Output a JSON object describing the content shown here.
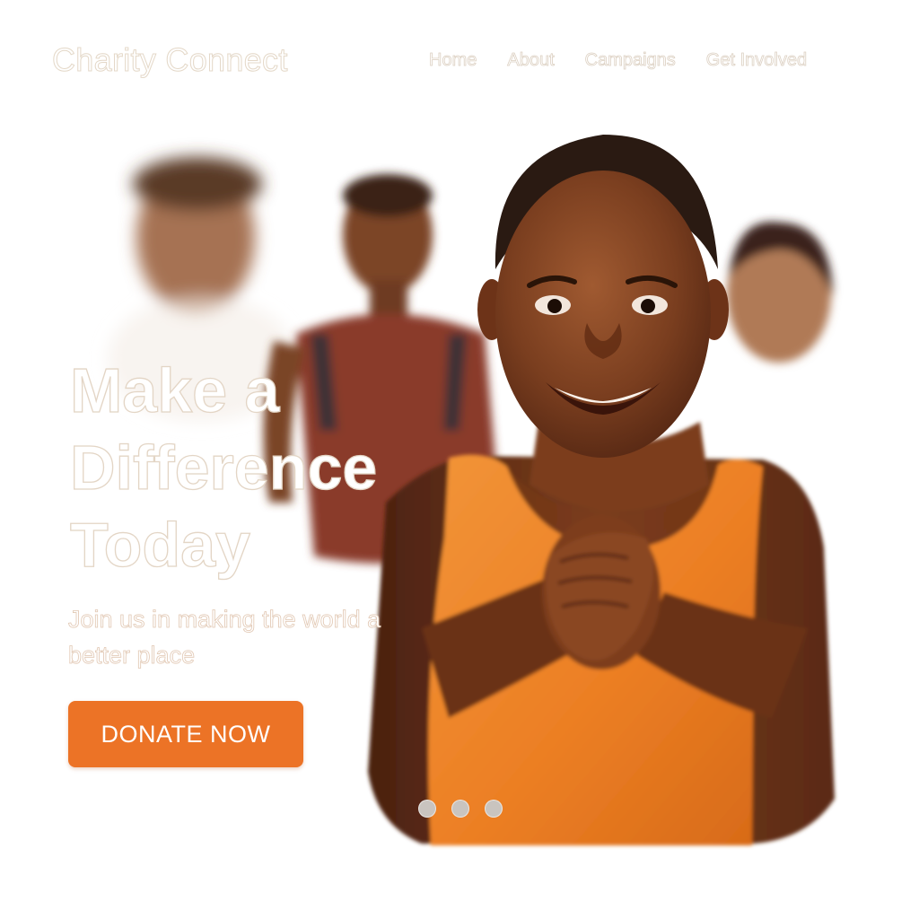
{
  "header": {
    "brand": "Charity Connect",
    "nav": [
      {
        "label": "Home"
      },
      {
        "label": "About"
      },
      {
        "label": "Campaigns"
      },
      {
        "label": "Get Involved"
      }
    ]
  },
  "hero": {
    "title": "Make a Difference Today",
    "subtitle": "Join us in making the world a better place",
    "cta_label": "DONATE NOW",
    "slide_count": 3
  },
  "colors": {
    "accent": "#ec7326",
    "shirt_orange": "#ee8a2c",
    "background": "#ffffff"
  }
}
